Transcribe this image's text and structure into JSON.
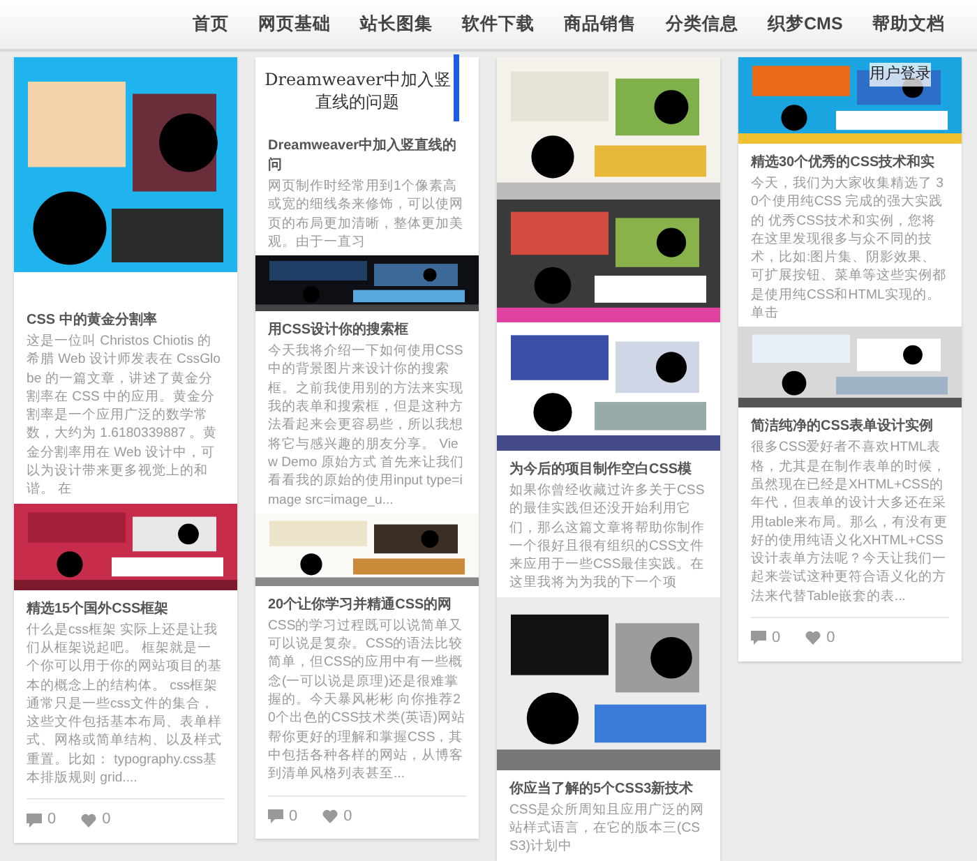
{
  "nav": [
    {
      "label": "首页"
    },
    {
      "label": "网页基础"
    },
    {
      "label": "站长图集"
    },
    {
      "label": "软件下载"
    },
    {
      "label": "商品销售"
    },
    {
      "label": "分类信息"
    },
    {
      "label": "织梦CMS"
    },
    {
      "label": "帮助文档"
    }
  ],
  "columns": [
    {
      "blocks": [
        {
          "kind": "picture"
        },
        {
          "kind": "post",
          "title": "CSS 中的黄金分割率",
          "text": "这是一位叫 Christos Chiotis 的希腊 Web 设计师发表在 CssGlobe 的一篇文章，讲述了黄金分割率在 CSS 中的应用。黄金分割率是一个应用广泛的数学常数，大约为 1.6180339887 。黄金分割率用在 Web 设计中，可以为设计带来更多视觉上的和谐。 在"
        },
        {
          "kind": "picture"
        },
        {
          "kind": "post",
          "title": "精选15个国外CSS框架",
          "text": "什么是css框架 实际上还是让我们从框架说起吧。 框架就是一个你可以用于你的网站项目的基本的概念上的结构体。 css框架通常只是一些css文件的集合，这些文件包括基本布局、表单样式、网格或简单结构、以及样式重置。比如： typography.css基本排版规则 grid....",
          "comments": "0",
          "likes": "0"
        }
      ]
    },
    {
      "blocks": [
        {
          "kind": "heading",
          "heading": "Dreamweaver中加入竖直线的问题"
        },
        {
          "kind": "post",
          "title": "Dreamweaver中加入竖直线的问",
          "text": "网页制作时经常用到1个像素高或宽的细线条来修饰，可以使网页的布局更加清晰，整体更加美观。由于一直习"
        },
        {
          "kind": "picture"
        },
        {
          "kind": "post",
          "title": "用CSS设计你的搜索框",
          "text": "今天我将介绍一下如何使用CSS中的背景图片来设计你的搜索框。之前我使用别的方法来实现我的表单和搜索框，但是这种方法看起来会更容易些，所以我想将它与感兴趣的朋友分享。 View Demo 原始方式 首先来让我们看看我的原始的使用input type=image src=image_u..."
        },
        {
          "kind": "picture"
        },
        {
          "kind": "post",
          "title": "20个让你学习并精通CSS的网",
          "text": "CSS的学习过程既可以说简单又可以说是复杂。CSS的语法比较简单，但CSS的应用中有一些概念(一可以说是原理)还是很难掌握的。今天暴风彬彬 向你推荐20个出色的CSS技术类(英语)网站帮你更好的理解和掌握CSS，其中包括各种各样的网站，从博客到清单风格列表甚至...",
          "comments": "0",
          "likes": "0"
        }
      ]
    },
    {
      "blocks": [
        {
          "kind": "picture"
        },
        {
          "kind": "picture"
        },
        {
          "kind": "picture"
        },
        {
          "kind": "post",
          "title": "为今后的项目制作空白CSS模",
          "text": "如果你曾经收藏过许多关于CSS的最佳实践但还没开始利用它们，那么这篇文章将帮助你制作一个很好且很有组织的CSS文件来应用于一些CSS最佳实践。在这里我将为为我的下一个项"
        },
        {
          "kind": "picture"
        },
        {
          "kind": "post",
          "title": "你应当了解的5个CSS3新技术",
          "text": "CSS是众所周知且应用广泛的网站样式语言，在它的版本三(CSS3)计划中"
        }
      ]
    },
    {
      "blocks": [
        {
          "kind": "picture",
          "overlay_link": "用户登录"
        },
        {
          "kind": "post",
          "title": "精选30个优秀的CSS技术和实",
          "text": "今天，我们为大家收集精选了 30个使用纯CSS 完成的强大实践的 优秀CSS技术和实例，您将在这里发现很多与众不同的技术，比如:图片集、阴影效果、可扩展按钮、菜单等这些实例都是使用纯CSS和HTML实现的。单击"
        },
        {
          "kind": "picture"
        },
        {
          "kind": "post",
          "title": "简洁纯净的CSS表单设计实例",
          "text": "很多CSS爱好者不喜欢HTML表格，尤其是在制作表单的时候，虽然现在已经是XHTML+CSS的年代，但表单的设计大多还在采用table来布局。那么，有没有更好的使用纯语义化XHTML+CSS设计表单方法呢？今天让我们一起来尝试这种更符合语义化的方法来代替Table嵌套的表...",
          "comments": "0",
          "likes": "0"
        }
      ]
    }
  ]
}
